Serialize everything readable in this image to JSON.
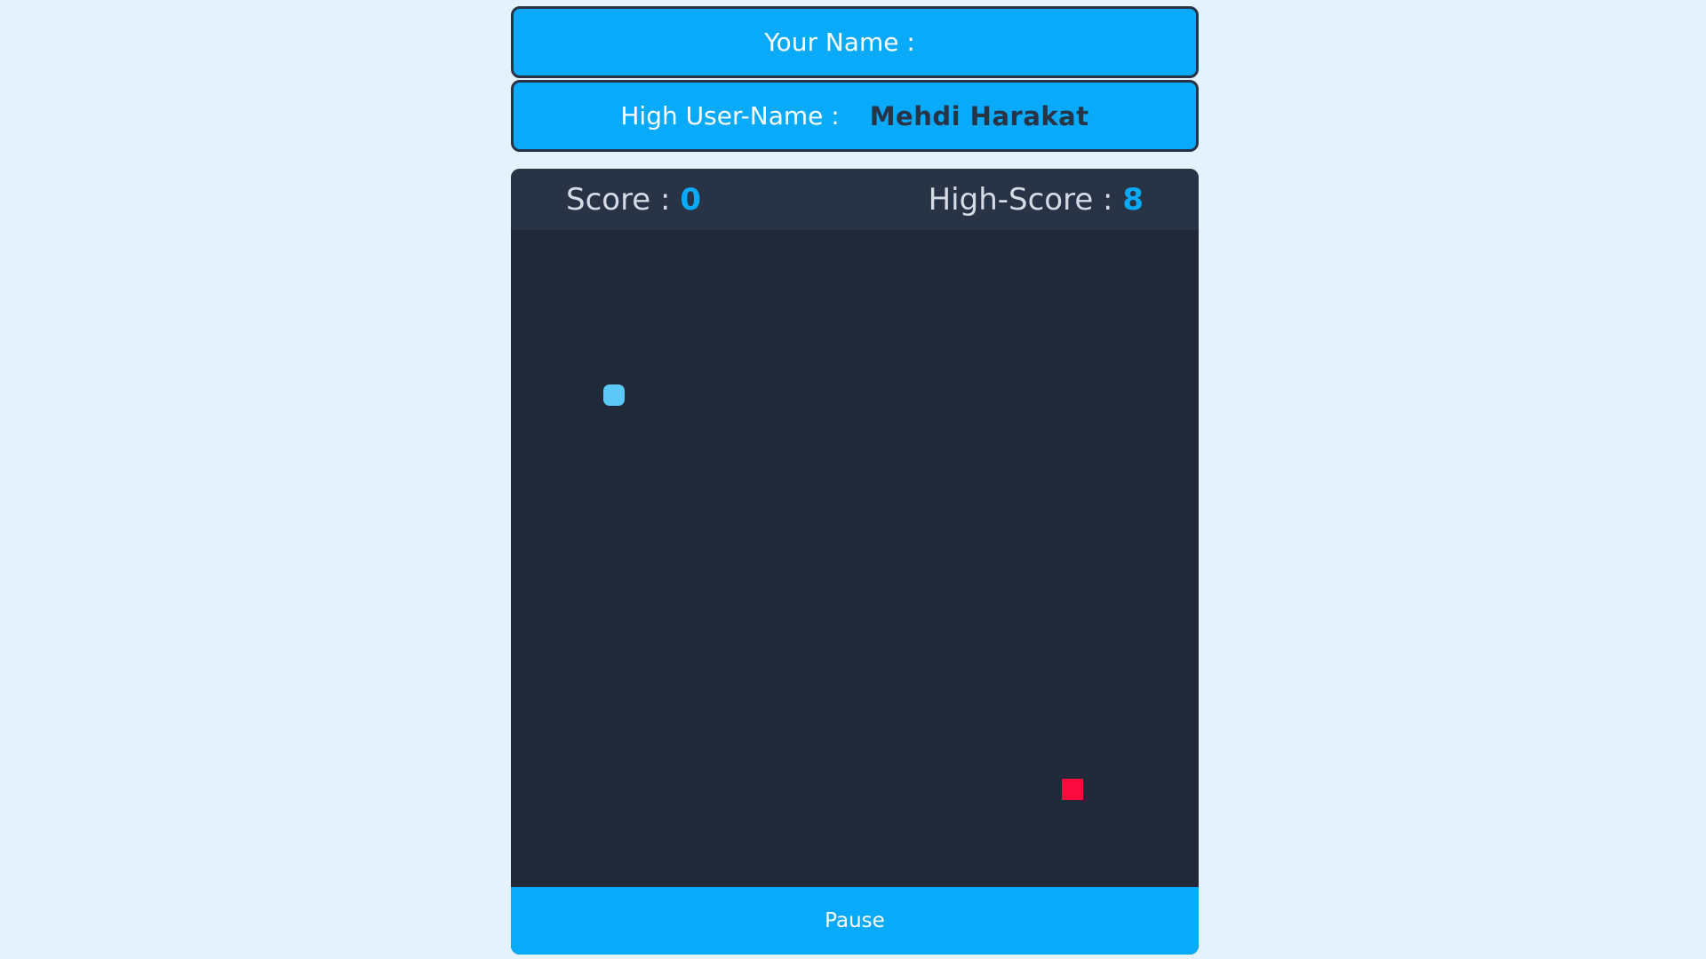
{
  "player": {
    "your_name_label": "Your Name :",
    "your_name_value": "",
    "high_user_label": "High User-Name :",
    "high_user_value": "Mehdi Harakat"
  },
  "scoreboard": {
    "score_label": "Score :",
    "score_value": "0",
    "high_score_label": "High-Score :",
    "high_score_value": "8"
  },
  "controls": {
    "pause_label": "Pause"
  },
  "colors": {
    "page_bg": "#e3f2fd",
    "accent": "#0aaafa",
    "board_bg": "#212838",
    "snake": "#5cc8f8",
    "food": "#fb0a3f"
  }
}
